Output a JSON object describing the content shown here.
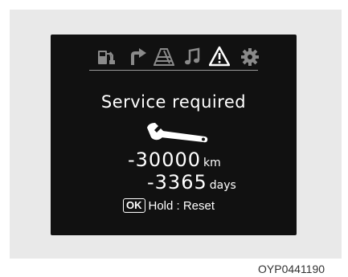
{
  "display": {
    "icons": [
      {
        "name": "trip-computer-icon",
        "active": false
      },
      {
        "name": "turn-navigation-icon",
        "active": false
      },
      {
        "name": "lane-road-icon",
        "active": false
      },
      {
        "name": "music-note-icon",
        "active": false
      },
      {
        "name": "warning-triangle-icon",
        "active": true
      },
      {
        "name": "gear-settings-icon",
        "active": false
      }
    ],
    "title": "Service required",
    "service_icon": "wrench-icon",
    "distance_value": "-30000",
    "distance_unit": "km",
    "time_value": "-3365",
    "time_unit": "days",
    "ok_label": "OK",
    "reset_text": "Hold : Reset"
  },
  "figure_code": "OYP0441190"
}
